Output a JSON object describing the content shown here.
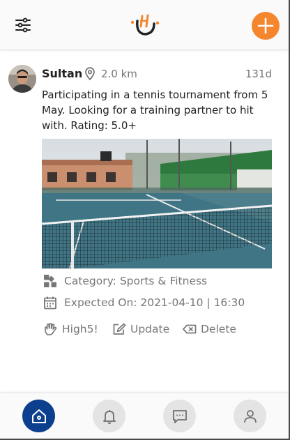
{
  "header": {
    "filter_icon": "sliders-icon",
    "logo_icon": "high5-logo",
    "add_icon": "plus-icon",
    "accent_color": "#f4862e"
  },
  "post": {
    "author": "Sultan",
    "distance": "2.0 km",
    "age": "131d",
    "text": "Participating in a tennis tournament from 5 May. Looking for a training partner to hit with. Rating: 5.0+",
    "category": "Category: Sports & Fitness",
    "expected": "Expected On: 2021-04-10 | 16:30",
    "actions": {
      "high5": "High5!",
      "update": "Update",
      "delete": "Delete"
    }
  },
  "bottom_nav": {
    "items": [
      {
        "icon": "home-icon",
        "active": true
      },
      {
        "icon": "bell-icon",
        "active": false
      },
      {
        "icon": "chat-icon",
        "active": false
      },
      {
        "icon": "user-icon",
        "active": false
      }
    ],
    "active_color": "#0d3f8f"
  }
}
